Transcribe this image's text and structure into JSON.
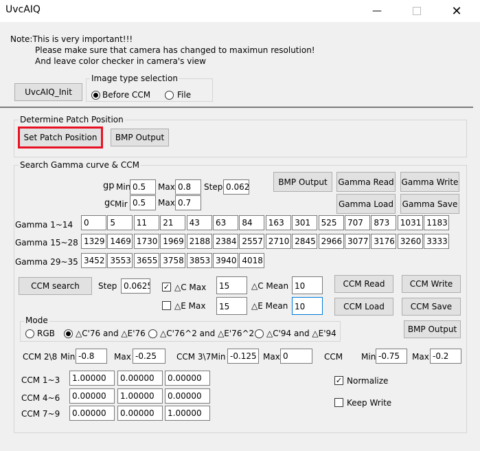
{
  "window": {
    "title": "UvcAIQ"
  },
  "note": {
    "line1": "Note:This is very important!!!",
    "line2": "Please make sure that camera has changed to maximun resolution!",
    "line3": "And leave color checker in camera's view"
  },
  "init_button": "UvcAIQ_Init",
  "image_type": {
    "legend": "Image type selection",
    "before_ccm": "Before CCM",
    "file": "File",
    "selected": "Before CCM"
  },
  "patch": {
    "legend": "Determine Patch Position",
    "set_button": "Set Patch Position",
    "bmp_button": "BMP Output"
  },
  "gamma_group": {
    "legend": "Search Gamma curve & CCM",
    "gp": {
      "label": "gp",
      "min_label": "Min",
      "min": "0.5",
      "max_label": "Max",
      "max": "0.8",
      "step_label": "Step",
      "step": "0.062"
    },
    "gc": {
      "label": "gc",
      "min_label": "Mir",
      "min": "0.5",
      "max_label": "Max",
      "max": "0.7"
    },
    "buttons": {
      "bmp": "BMP Output",
      "gamma_read": "Gamma Read",
      "gamma_write": "Gamma Write",
      "gamma_load": "Gamma Load",
      "gamma_save": "Gamma Save"
    },
    "rows": [
      {
        "label": "Gamma 1~14",
        "values": [
          "0",
          "5",
          "11",
          "21",
          "43",
          "63",
          "84",
          "163",
          "301",
          "525",
          "707",
          "873",
          "1031",
          "1183"
        ]
      },
      {
        "label": "Gamma 15~28",
        "values": [
          "1329",
          "1469",
          "1730",
          "1969",
          "2188",
          "2384",
          "2557",
          "2710",
          "2845",
          "2966",
          "3077",
          "3176",
          "3260",
          "3333"
        ]
      },
      {
        "label": "Gamma 29~35",
        "values": [
          "3452",
          "3553",
          "3655",
          "3758",
          "3853",
          "3940",
          "4018"
        ]
      }
    ]
  },
  "ccm": {
    "search_button": "CCM search",
    "step_label": "Step",
    "step": "0.0625",
    "dc_checked": true,
    "dc_max_label": "△C Max",
    "dc_max": "15",
    "dc_mean_label": "△C Mean",
    "dc_mean": "10",
    "de_checked": false,
    "de_max_label": "△E Max",
    "de_max": "15",
    "de_mean_label": "△E Mean",
    "de_mean": "10",
    "read": "CCM Read",
    "write": "CCM Write",
    "load": "CCM Load",
    "save": "CCM Save",
    "bmp": "BMP Output"
  },
  "mode": {
    "legend": "Mode",
    "options": [
      "RGB",
      "△C'76 and △E'76",
      "△C'76^2 and △E'76^2",
      "△C'94 and △E'94"
    ],
    "selected": "△C'76 and △E'76"
  },
  "ccm_range": {
    "r28": {
      "label": "CCM 2\\8",
      "min_label": "Min",
      "min": "-0.8",
      "max_label": "Max",
      "max": "-0.25"
    },
    "r37": {
      "label": "CCM 3\\7Min",
      "min": "-0.125",
      "max_label": "Max",
      "max": "0"
    },
    "r": {
      "label": "CCM",
      "min_label": "Min",
      "min": "-0.75",
      "max_label": "Max",
      "max": "-0.2"
    }
  },
  "matrix": {
    "rows": [
      {
        "label": "CCM 1~3",
        "values": [
          "1.00000",
          "0.00000",
          "0.00000"
        ]
      },
      {
        "label": "CCM 4~6",
        "values": [
          "0.00000",
          "1.00000",
          "0.00000"
        ]
      },
      {
        "label": "CCM 7~9",
        "values": [
          "0.00000",
          "0.00000",
          "1.00000"
        ]
      }
    ],
    "normalize": "Normalize",
    "normalize_checked": true,
    "keep_write": "Keep Write",
    "keep_checked": false
  }
}
